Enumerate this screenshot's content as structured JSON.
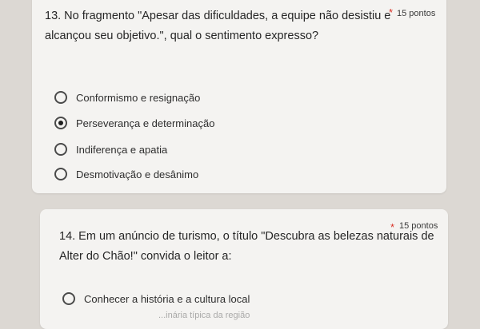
{
  "q13": {
    "text_line1": "13. No fragmento \"Apesar das dificuldades, a equipe não desistiu e",
    "text_line2": "alcançou seu objetivo.\", qual o sentimento expresso?",
    "required": "*",
    "points": "15 pontos",
    "options": [
      {
        "label": "Conformismo e resignação",
        "checked": false
      },
      {
        "label": "Perseverança e determinação",
        "checked": true
      },
      {
        "label": "Indiferença e apatia",
        "checked": false
      },
      {
        "label": "Desmotivação e desânimo",
        "checked": false
      }
    ]
  },
  "q14": {
    "text_line1": "14. Em um anúncio de turismo, o título \"Descubra as belezas naturais de",
    "text_line2": "Alter do Chão!\" convida o leitor a:",
    "required": "*",
    "points": "15 pontos",
    "options": [
      {
        "label": "Conhecer a história e a cultura local",
        "checked": false
      }
    ],
    "partial_option": "...inária típica da região"
  }
}
